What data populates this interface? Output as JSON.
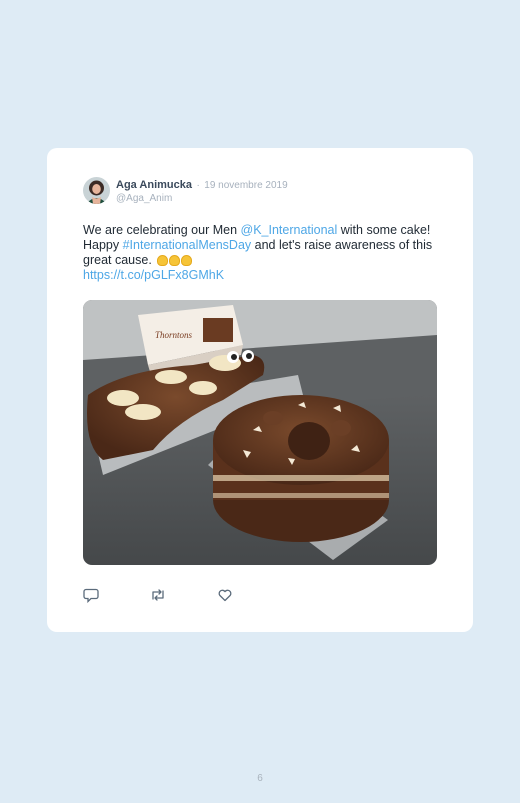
{
  "tweet": {
    "author_name": "Aga Animucka",
    "separator": "·",
    "date": "19 novembre 2019",
    "handle": "@Aga_Anim",
    "text_1": "We are celebrating our Men ",
    "mention": "@K_International",
    "text_2": " with some cake! Happy ",
    "hashtag": "#InternationalMensDay",
    "text_3": " and let's raise awareness of this great cause. ",
    "emoji": "flexed-biceps x3",
    "url": "https://t.co/pGLFx8GMhK",
    "image": "photo of two chocolate cakes (a chocolate log/animal cake and a layered chocolate cake) beside a Thorntons box"
  },
  "actions": [
    {
      "name": "reply",
      "icon": "reply-icon"
    },
    {
      "name": "retweet",
      "icon": "retweet-icon"
    },
    {
      "name": "like",
      "icon": "heart-icon"
    }
  ],
  "box_brand": "Thorntons",
  "page_number": "6",
  "colors": {
    "background": "#deebf5",
    "card": "#ffffff",
    "link": "#4ea7e6",
    "muted": "#a7b1bd"
  }
}
